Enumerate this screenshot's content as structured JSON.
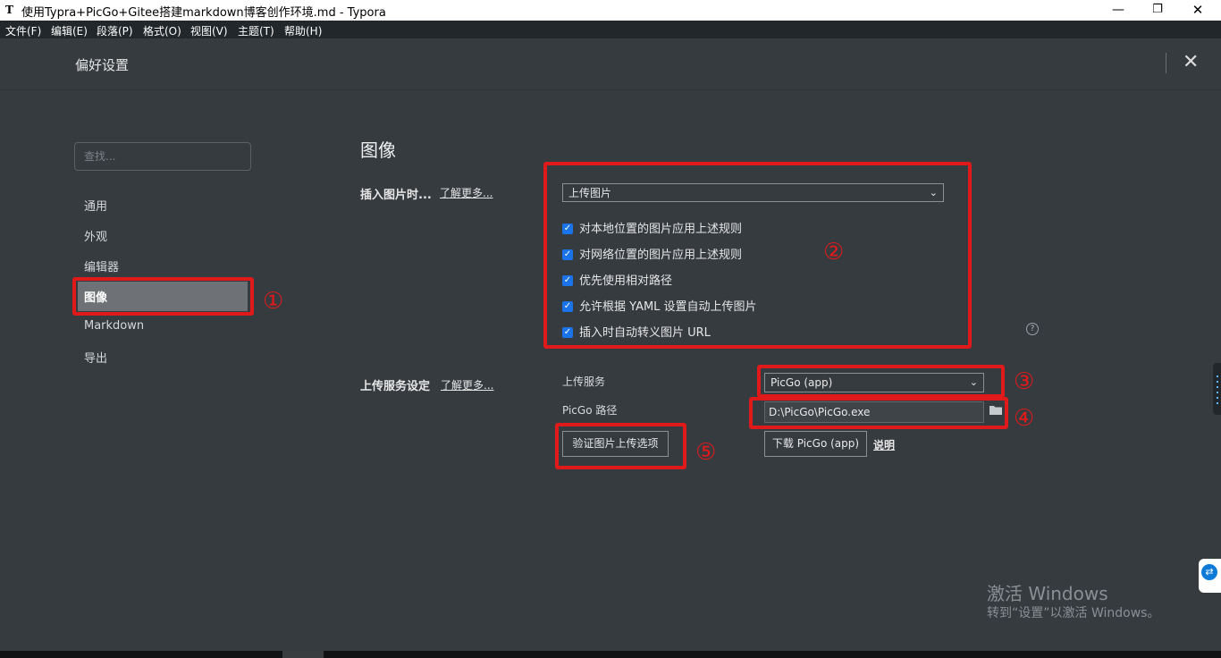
{
  "window": {
    "title": "使用Typra+PicGo+Gitee搭建markdown博客创作环境.md - Typora",
    "app_icon": "T",
    "minimize_icon": "—",
    "restore_icon": "❐",
    "close_icon": "✕"
  },
  "menu": [
    "文件(F)",
    "编辑(E)",
    "段落(P)",
    "格式(O)",
    "视图(V)",
    "主题(T)",
    "帮助(H)"
  ],
  "header": {
    "title": "偏好设置",
    "close_icon": "✕"
  },
  "sidebar": {
    "search_placeholder": "查找...",
    "items": [
      "通用",
      "外观",
      "编辑器",
      "图像",
      "Markdown",
      "导出"
    ],
    "active_index": 3
  },
  "main": {
    "section_title": "图像",
    "insert": {
      "label": "插入图片时...",
      "learn_more": "了解更多...",
      "selected": "上传图片",
      "options": [
        {
          "label": "对本地位置的图片应用上述规则",
          "checked": true
        },
        {
          "label": "对网络位置的图片应用上述规则",
          "checked": true
        },
        {
          "label": "优先使用相对路径",
          "checked": true
        },
        {
          "label": "允许根据 YAML 设置自动上传图片",
          "checked": true
        },
        {
          "label": "插入时自动转义图片 URL",
          "checked": true
        }
      ],
      "help_icon": "?"
    },
    "upload": {
      "label": "上传服务设定",
      "learn_more": "了解更多...",
      "service_label": "上传服务",
      "service_value": "PicGo (app)",
      "path_label": "PicGo 路径",
      "path_value": "D:\\PicGo\\PicGo.exe",
      "verify_button": "验证图片上传选项",
      "download_button": "下载 PicGo (app)",
      "explain_link": "说明"
    }
  },
  "annotations": {
    "color": "#e01a1a",
    "labels": [
      "①",
      "②",
      "③",
      "④",
      "⑤"
    ]
  },
  "watermark": {
    "line1": "激活 Windows",
    "line2": "转到“设置”以激活 Windows。"
  }
}
